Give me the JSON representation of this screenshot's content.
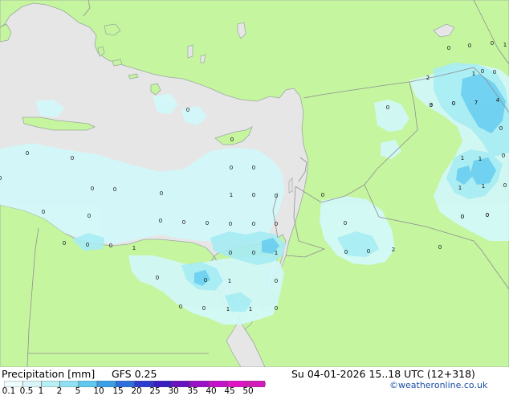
{
  "map": {
    "colors": {
      "sea": "#e6e6e6",
      "land": "#c6f5a0",
      "border": "#8f8f8f",
      "coast": "#9aa9a0",
      "precip_light": "#d2f8fa",
      "precip_mid": "#a6ecf4",
      "precip_heavy": "#67cdf0"
    },
    "point_values": [
      {
        "id": "p1",
        "v": "0"
      },
      {
        "id": "p2",
        "v": "0"
      },
      {
        "id": "p3",
        "v": "0"
      },
      {
        "id": "p4",
        "v": "0"
      },
      {
        "id": "p5",
        "v": "0"
      },
      {
        "id": "p6",
        "v": "0"
      },
      {
        "id": "p7",
        "v": "0"
      },
      {
        "id": "p8",
        "v": "0"
      },
      {
        "id": "p9",
        "v": "0"
      },
      {
        "id": "p10",
        "v": "0"
      },
      {
        "id": "p11",
        "v": "0"
      },
      {
        "id": "p12",
        "v": "0"
      },
      {
        "id": "p13",
        "v": "0"
      },
      {
        "id": "p14",
        "v": "1"
      },
      {
        "id": "p15",
        "v": "0"
      },
      {
        "id": "p16",
        "v": "0"
      },
      {
        "id": "p17",
        "v": "0"
      },
      {
        "id": "p18",
        "v": "0"
      },
      {
        "id": "p19",
        "v": "0"
      },
      {
        "id": "p20",
        "v": "0"
      },
      {
        "id": "p21",
        "v": "0"
      },
      {
        "id": "p22",
        "v": "0"
      },
      {
        "id": "p23",
        "v": "0"
      },
      {
        "id": "p24",
        "v": "0"
      },
      {
        "id": "p25",
        "v": "0"
      },
      {
        "id": "p26",
        "v": "0"
      },
      {
        "id": "p27",
        "v": "0"
      },
      {
        "id": "p28",
        "v": "0"
      },
      {
        "id": "p29",
        "v": "0"
      },
      {
        "id": "p30",
        "v": "0"
      },
      {
        "id": "p31",
        "v": "0"
      },
      {
        "id": "p32",
        "v": "1"
      },
      {
        "id": "p33",
        "v": "0"
      },
      {
        "id": "p34",
        "v": "0"
      },
      {
        "id": "p35",
        "v": "1"
      },
      {
        "id": "p36",
        "v": "0"
      },
      {
        "id": "p37",
        "v": "0"
      },
      {
        "id": "p38",
        "v": "2"
      },
      {
        "id": "p39",
        "v": "0"
      },
      {
        "id": "p40",
        "v": "0"
      },
      {
        "id": "p41",
        "v": "0"
      },
      {
        "id": "p42",
        "v": "1"
      },
      {
        "id": "p43",
        "v": "0"
      },
      {
        "id": "p44",
        "v": "0"
      },
      {
        "id": "p45",
        "v": "0"
      },
      {
        "id": "p46",
        "v": "1"
      },
      {
        "id": "p47",
        "v": "1"
      },
      {
        "id": "p48",
        "v": "0"
      },
      {
        "id": "p49",
        "v": "0"
      },
      {
        "id": "p50",
        "v": "0"
      },
      {
        "id": "p51",
        "v": "1"
      },
      {
        "id": "p52",
        "v": "0"
      },
      {
        "id": "p53",
        "v": "0"
      },
      {
        "id": "p54",
        "v": "2"
      },
      {
        "id": "p55",
        "v": "1"
      },
      {
        "id": "p56",
        "v": "0"
      },
      {
        "id": "p57",
        "v": "0"
      },
      {
        "id": "p58",
        "v": "3"
      },
      {
        "id": "p59",
        "v": "7"
      },
      {
        "id": "p60",
        "v": "4"
      },
      {
        "id": "p61",
        "v": "0"
      },
      {
        "id": "p62",
        "v": "1"
      },
      {
        "id": "p63",
        "v": "1"
      },
      {
        "id": "p64",
        "v": "0"
      },
      {
        "id": "p65",
        "v": "1"
      },
      {
        "id": "p66",
        "v": "1"
      },
      {
        "id": "p67",
        "v": "0"
      },
      {
        "id": "p68",
        "v": "0"
      },
      {
        "id": "p69",
        "v": "0"
      }
    ]
  },
  "legend": {
    "title": "Precipitation [mm]",
    "model": "GFS 0.25",
    "valid_time": "Su 04-01-2026 15..18 UTC (12+318)",
    "credit": "©weatheronline.co.uk",
    "scale_ticks": [
      "0.1",
      "0.5",
      "1",
      "2",
      "5",
      "10",
      "15",
      "20",
      "25",
      "30",
      "35",
      "40",
      "45",
      "50"
    ],
    "scale_colors": [
      "#f0fcfc",
      "#d8f6fa",
      "#b8eef6",
      "#8fe0f2",
      "#60c8ee",
      "#3a9fe6",
      "#2f6fdc",
      "#2c3cd0",
      "#3a1fc0",
      "#6a12c0",
      "#9a10c6",
      "#c410c8",
      "#e014c4",
      "#d01eb8"
    ]
  }
}
